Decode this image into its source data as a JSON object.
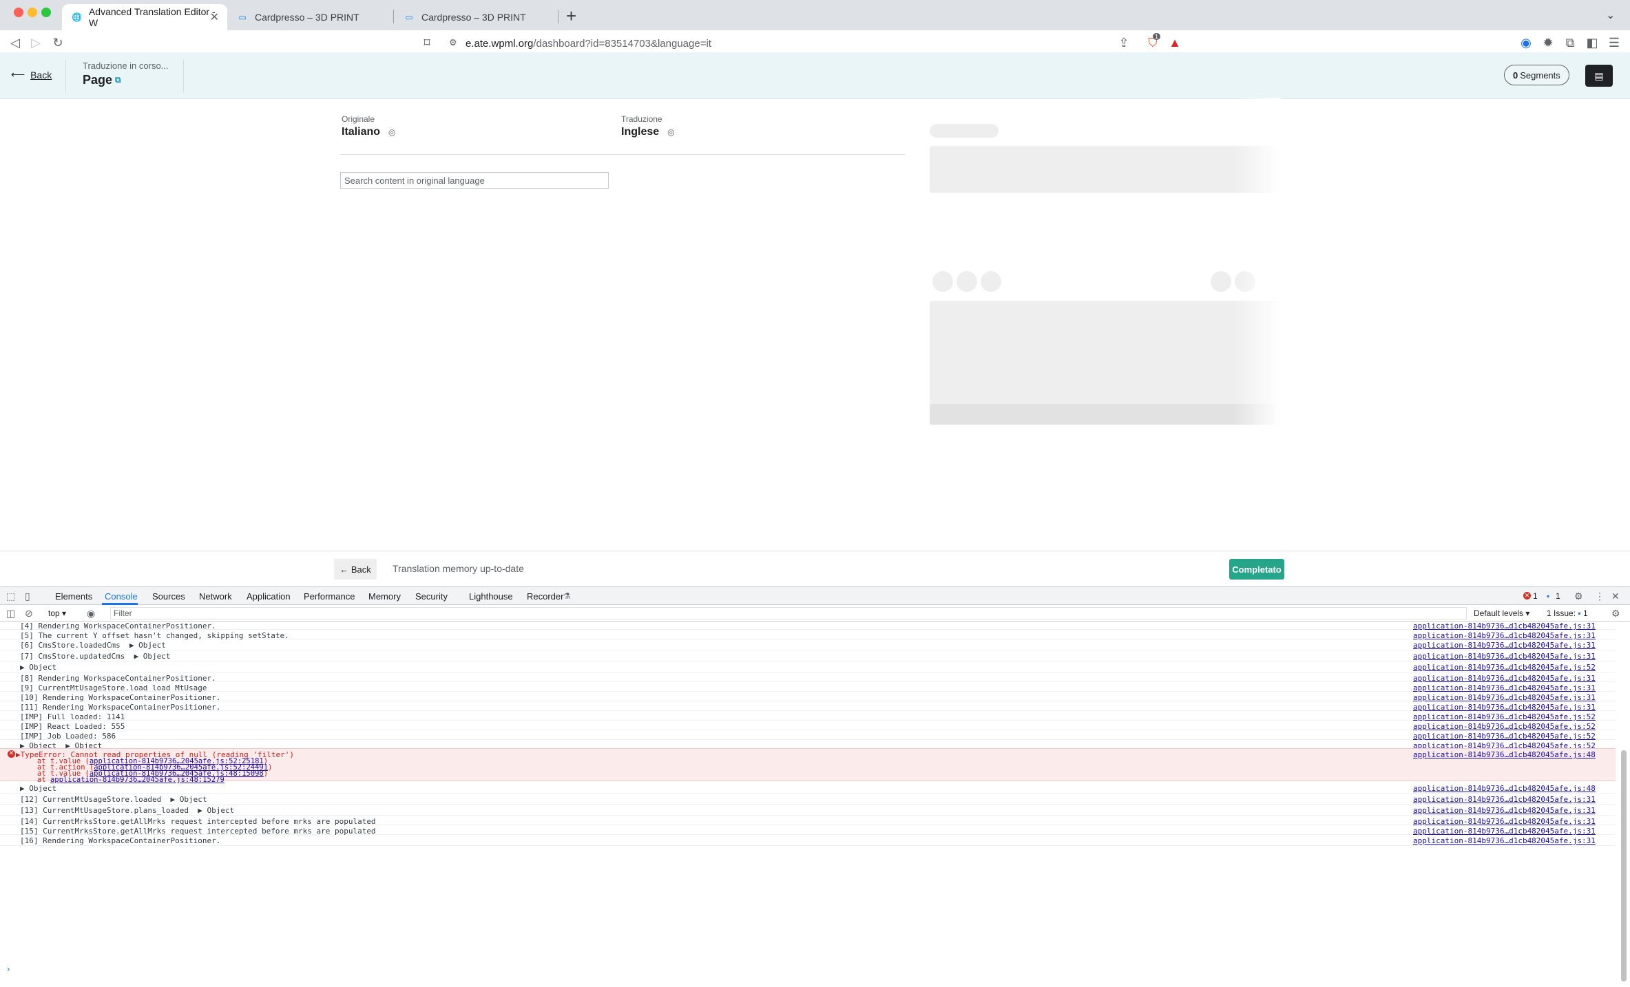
{
  "browser": {
    "tabs": [
      {
        "title": "Advanced Translation Editor - W",
        "active": true
      },
      {
        "title": "Cardpresso – 3D PRINT",
        "active": false
      },
      {
        "title": "Cardpresso – 3D PRINT",
        "active": false
      }
    ],
    "url_host": "e.ate.wpml.org",
    "url_path": "/dashboard?id=83514703&language=it",
    "shield_badge": "1"
  },
  "header": {
    "back_label": "Back",
    "status": "Traduzione in corso...",
    "title": "Page",
    "segments_count": "0",
    "segments_label": "Segments"
  },
  "editor": {
    "original_label": "Originale",
    "original_language": "Italiano",
    "translation_label": "Traduzione",
    "translation_language": "Inglese",
    "search_placeholder": "Search content in original language"
  },
  "footer": {
    "back_label": "← Back",
    "tm_status": "Translation memory up-to-date",
    "complete_label": "Completato"
  },
  "devtools": {
    "tabs": [
      "Elements",
      "Console",
      "Sources",
      "Network",
      "Application",
      "Performance",
      "Memory",
      "Security",
      "Lighthouse",
      "Recorder"
    ],
    "context": "top",
    "filter_placeholder": "Filter",
    "levels": "Default levels",
    "error_count": "1",
    "message_count": "1",
    "issues_label": "1 Issue:",
    "issues_count": "1",
    "log": [
      {
        "msg": "[4] Rendering WorkspaceContainerPositioner.",
        "src": "application-814b9736…d1cb482045afe.js:31"
      },
      {
        "msg": "[5] The current Y offset hasn't changed, skipping setState.",
        "src": "application-814b9736…d1cb482045afe.js:31"
      },
      {
        "msg": "[6] CmsStore.loadedCms  ▶ Object",
        "src": "application-814b9736…d1cb482045afe.js:31"
      },
      {
        "msg": "[7] CmsStore.updatedCms  ▶ Object",
        "src": "application-814b9736…d1cb482045afe.js:31"
      },
      {
        "msg": "▶ Object",
        "src": "application-814b9736…d1cb482045afe.js:52"
      },
      {
        "msg": "[8] Rendering WorkspaceContainerPositioner.",
        "src": "application-814b9736…d1cb482045afe.js:31"
      },
      {
        "msg": "[9] CurrentMtUsageStore.load load MtUsage",
        "src": "application-814b9736…d1cb482045afe.js:31"
      },
      {
        "msg": "[10] Rendering WorkspaceContainerPositioner.",
        "src": "application-814b9736…d1cb482045afe.js:31"
      },
      {
        "msg": "[11] Rendering WorkspaceContainerPositioner.",
        "src": "application-814b9736…d1cb482045afe.js:31"
      },
      {
        "msg": "[IMP] Full loaded: 1141",
        "src": "application-814b9736…d1cb482045afe.js:52"
      },
      {
        "msg": "[IMP] React Loaded: 555",
        "src": "application-814b9736…d1cb482045afe.js:52"
      },
      {
        "msg": "[IMP] Job Loaded: 586",
        "src": "application-814b9736…d1cb482045afe.js:52"
      },
      {
        "msg": "▶ Object  ▶ Object",
        "src": "application-814b9736…d1cb482045afe.js:52"
      }
    ],
    "error": {
      "msg": "▶TypeError: Cannot read properties of null (reading 'filter')",
      "src": "application-814b9736…d1cb482045afe.js:48",
      "stack": [
        {
          "prefix": "at t.value (",
          "link": "application-814b9736…2045afe.js:52:25181",
          "suffix": ")"
        },
        {
          "prefix": "at t.action (",
          "link": "application-814b9736…2045afe.js:52:24491",
          "suffix": ")"
        },
        {
          "prefix": "at t.value (",
          "link": "application-814b9736…2045afe.js:48:15098",
          "suffix": ")"
        },
        {
          "prefix": "at ",
          "link": "application-814b9736…2045afe.js:48:15279",
          "suffix": ""
        }
      ]
    },
    "log_after": [
      {
        "msg": "▶ Object",
        "src": "application-814b9736…d1cb482045afe.js:48"
      },
      {
        "msg": "[12] CurrentMtUsageStore.loaded  ▶ Object",
        "src": "application-814b9736…d1cb482045afe.js:31"
      },
      {
        "msg": "[13] CurrentMtUsageStore.plans_loaded  ▶ Object",
        "src": "application-814b9736…d1cb482045afe.js:31"
      },
      {
        "msg": "[14] CurrentMrksStore.getAllMrks request intercepted before mrks are populated",
        "src": "application-814b9736…d1cb482045afe.js:31"
      },
      {
        "msg": "[15] CurrentMrksStore.getAllMrks request intercepted before mrks are populated",
        "src": "application-814b9736…d1cb482045afe.js:31"
      },
      {
        "msg": "[16] Rendering WorkspaceContainerPositioner.",
        "src": "application-814b9736…d1cb482045afe.js:31"
      }
    ]
  },
  "colors": {
    "accent": "#27a58a",
    "header_bg": "#e9f5f7",
    "devtools_active": "#1a73e8",
    "error": "#d93025"
  }
}
